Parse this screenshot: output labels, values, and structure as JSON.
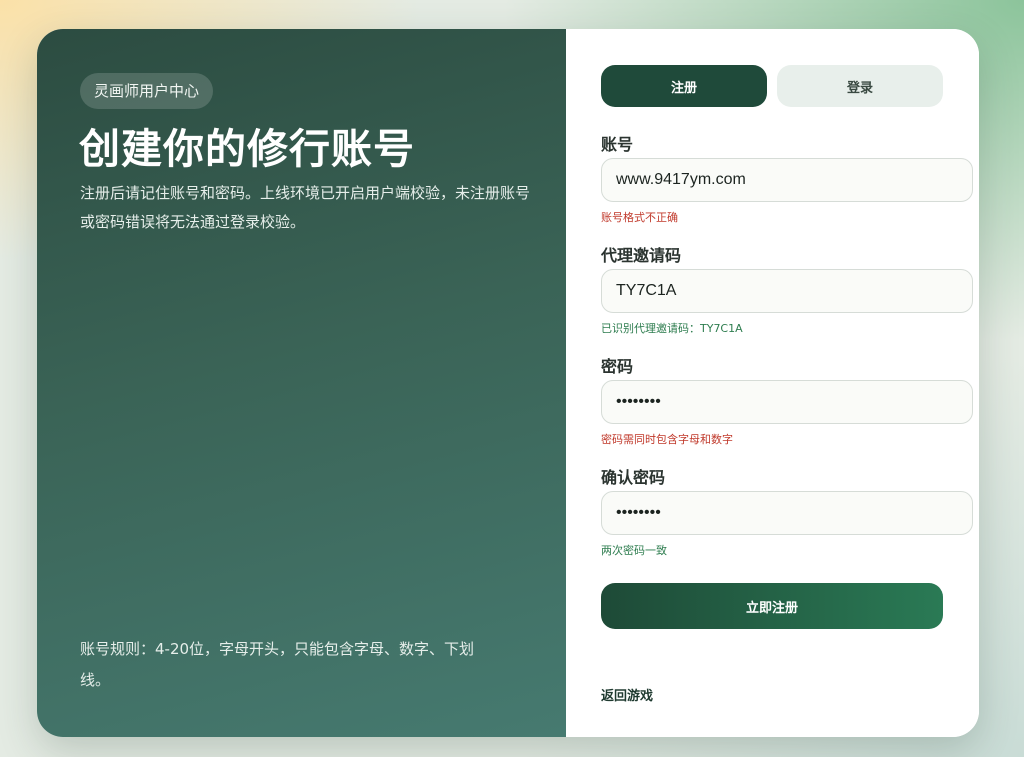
{
  "hero": {
    "badge": "灵画师用户中心",
    "title": "创建你的修行账号",
    "description": "注册后请记住账号和密码。上线环境已开启用户端校验，未注册账号或密码错误将无法通过登录校验。",
    "rule": "账号规则：4-20位，字母开头，只能包含字母、数字、下划线。"
  },
  "tabs": {
    "register": "注册",
    "login": "登录"
  },
  "fields": {
    "account": {
      "label": "账号",
      "value": "www.9417ym.com",
      "hint": "账号格式不正确"
    },
    "invite": {
      "label": "代理邀请码",
      "value": "TY7C1A",
      "hint": "已识别代理邀请码：TY7C1A"
    },
    "password": {
      "label": "密码",
      "value": "12345678",
      "hint": "密码需同时包含字母和数字"
    },
    "confirm": {
      "label": "确认密码",
      "value": "12345678",
      "hint": "两次密码一致"
    }
  },
  "submit_label": "立即注册",
  "back_label": "返回游戏",
  "colors": {
    "accent": "#1f4a3a",
    "error": "#c0392b",
    "success": "#2e7d4f"
  }
}
